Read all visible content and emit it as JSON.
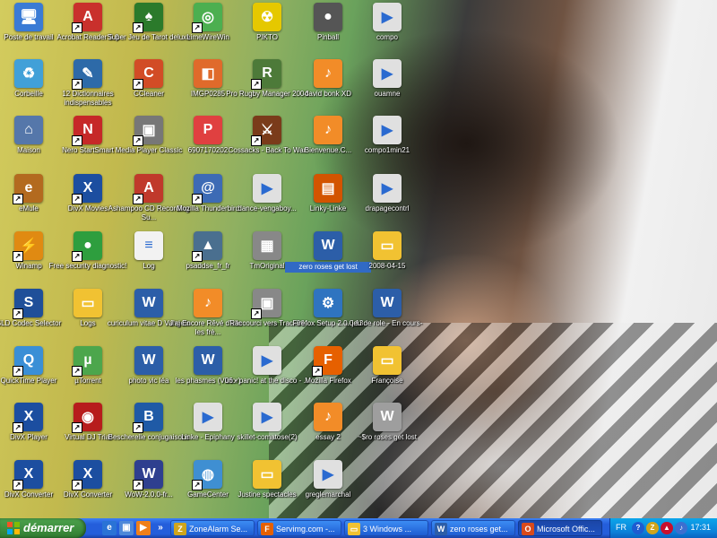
{
  "desktop_icons": [
    {
      "label": "Poste de travail",
      "symbol": "🖥",
      "color": "#3a7bd5"
    },
    {
      "label": "Acrobat Reader 5.0",
      "symbol": "A",
      "color": "#c9302c",
      "shortcut": true
    },
    {
      "label": "Super Jeu de Tarot deluxe",
      "symbol": "♠",
      "color": "#2b7a2b",
      "shortcut": true
    },
    {
      "label": "LimeWireWin",
      "symbol": "◎",
      "color": "#4caf50",
      "shortcut": true
    },
    {
      "label": "PIKTO",
      "symbol": "☢",
      "color": "#e5c800"
    },
    {
      "label": "Pinball",
      "symbol": "●",
      "color": "#555"
    },
    {
      "label": "compo",
      "symbol": "▶",
      "color": "#e0e0e0"
    },
    {
      "label": "Corbeille",
      "symbol": "♻",
      "color": "#41a0d8"
    },
    {
      "label": "12 Dictionnaires indispensables",
      "symbol": "✎",
      "color": "#2d6aa8",
      "shortcut": true
    },
    {
      "label": "CCleaner",
      "symbol": "C",
      "color": "#d24c26",
      "shortcut": true
    },
    {
      "label": "IMGP0285",
      "symbol": "◧",
      "color": "#e06a2b"
    },
    {
      "label": "Pro Rugby Manager 2004",
      "symbol": "R",
      "color": "#4d7a39",
      "shortcut": true
    },
    {
      "label": "david bonk XD",
      "symbol": "♪",
      "color": "#f28c28"
    },
    {
      "label": "ouamne",
      "symbol": "▶",
      "color": "#e0e0e0"
    },
    {
      "label": "Maison",
      "symbol": "⌂",
      "color": "#5577aa"
    },
    {
      "label": "Nero StartSmart",
      "symbol": "N",
      "color": "#c62828",
      "shortcut": true
    },
    {
      "label": "Media Player Classic",
      "symbol": "▣",
      "color": "#777",
      "shortcut": true
    },
    {
      "label": "6907170202",
      "symbol": "P",
      "color": "#e04040"
    },
    {
      "label": "Cossacks - Back To War",
      "symbol": "⚔",
      "color": "#7a3b1a",
      "shortcut": true
    },
    {
      "label": "Bienvenue.C...",
      "symbol": "♪",
      "color": "#f28c28"
    },
    {
      "label": "compo1min21",
      "symbol": "▶",
      "color": "#e0e0e0"
    },
    {
      "label": "eMule",
      "symbol": "e",
      "color": "#b36a1f",
      "shortcut": true
    },
    {
      "label": "DivX Movies",
      "symbol": "X",
      "color": "#1c4ea0",
      "shortcut": true
    },
    {
      "label": "Ashampoo CD Recording Su...",
      "symbol": "A",
      "color": "#c0392b",
      "shortcut": true
    },
    {
      "label": "Mozilla Thunderbird",
      "symbol": "@",
      "color": "#3d6bb5",
      "shortcut": true
    },
    {
      "label": "dance-vengaboy...",
      "symbol": "▶",
      "color": "#e0e0e0"
    },
    {
      "label": "Linky-Linke",
      "symbol": "▤",
      "color": "#d35400"
    },
    {
      "label": "drapagecontrl",
      "symbol": "▶",
      "color": "#e0e0e0"
    },
    {
      "label": "Winamp",
      "symbol": "⚡",
      "color": "#e08a12",
      "shortcut": true
    },
    {
      "label": "Free security diagnostic!",
      "symbol": "●",
      "color": "#2e9e3e",
      "shortcut": true
    },
    {
      "label": "Log",
      "symbol": "≡",
      "color": "#f2f2f2"
    },
    {
      "label": "psaddse_fr_fr",
      "symbol": "▲",
      "color": "#4a6f8f",
      "shortcut": true
    },
    {
      "label": "TmOriginal",
      "symbol": "▦",
      "color": "#888"
    },
    {
      "label": "zero roses get lost",
      "symbol": "W",
      "color": "#2c5ea8",
      "selected": true
    },
    {
      "label": "2008-04-15",
      "symbol": "▭",
      "color": "#f1c232"
    },
    {
      "label": "SLD Codec Selector",
      "symbol": "S",
      "color": "#1f4f99",
      "shortcut": true
    },
    {
      "label": "Logs",
      "symbol": "▭",
      "color": "#f1c232"
    },
    {
      "label": "curiculum vitae D Vangelo",
      "symbol": "W",
      "color": "#2c5ea8"
    },
    {
      "label": "J'ai Encore Rêvé d'elle - les frè...",
      "symbol": "♪",
      "color": "#f28c28"
    },
    {
      "label": "Raccourci vers Track06",
      "symbol": "▣",
      "color": "#888",
      "shortcut": true
    },
    {
      "label": "Firefox Setup 2.0.0.13",
      "symbol": "⚙",
      "color": "#2f74c0"
    },
    {
      "label": "jeu de role - En cours-",
      "symbol": "W",
      "color": "#2c5ea8"
    },
    {
      "label": "QuickTime Player",
      "symbol": "Q",
      "color": "#3a8fd6",
      "shortcut": true
    },
    {
      "label": "µTorrent",
      "symbol": "µ",
      "color": "#4ca64c",
      "shortcut": true
    },
    {
      "label": "photo vic léa",
      "symbol": "W",
      "color": "#2c5ea8"
    },
    {
      "label": "les phasmes (Victor)",
      "symbol": "W",
      "color": "#2c5ea8"
    },
    {
      "label": "06 - panic! at the disco - ...",
      "symbol": "▶",
      "color": "#e0e0e0"
    },
    {
      "label": "Mozilla Firefox",
      "symbol": "F",
      "color": "#e66000",
      "shortcut": true
    },
    {
      "label": "Françoise",
      "symbol": "▭",
      "color": "#f1c232"
    },
    {
      "label": "DivX Player",
      "symbol": "X",
      "color": "#1c4ea0",
      "shortcut": true
    },
    {
      "label": "Virtual DJ Trial",
      "symbol": "◉",
      "color": "#b71c1c",
      "shortcut": true
    },
    {
      "label": "Bescherelle conjugaisons",
      "symbol": "B",
      "color": "#1f5aa6",
      "shortcut": true
    },
    {
      "label": "Linke - Epiphany",
      "symbol": "▶",
      "color": "#e0e0e0"
    },
    {
      "label": "skillet-comatose(2)",
      "symbol": "▶",
      "color": "#e0e0e0"
    },
    {
      "label": "essay 2",
      "symbol": "♪",
      "color": "#f28c28"
    },
    {
      "label": "~$ro roses get lost",
      "symbol": "W",
      "color": "#9e9e9e"
    },
    {
      "label": "DivX Converter",
      "symbol": "X",
      "color": "#1c4ea0",
      "shortcut": true
    },
    {
      "label": "DivX Converter",
      "symbol": "X",
      "color": "#1c4ea0",
      "shortcut": true
    },
    {
      "label": "WoW-2.0.0-fr...",
      "symbol": "W",
      "color": "#2e3f8f",
      "shortcut": true
    },
    {
      "label": "GameCenter",
      "symbol": "◍",
      "color": "#3f8fd2",
      "shortcut": true
    },
    {
      "label": "Justine spectacles",
      "symbol": "▭",
      "color": "#f1c232"
    },
    {
      "label": "greglemarchal",
      "symbol": "▶",
      "color": "#e0e0e0"
    }
  ],
  "taskbar": {
    "start_label": "démarrer",
    "quick_launch": [
      {
        "name": "ie-quick-launch",
        "symbol": "e",
        "color": "#2a73d6"
      },
      {
        "name": "window-quick-launch",
        "symbol": "▣",
        "color": "#4d88d9"
      },
      {
        "name": "media-quick-launch",
        "symbol": "▶",
        "color": "#ef7f1a"
      },
      {
        "name": "more-quick-launch",
        "symbol": "»",
        "color": "transparent"
      }
    ],
    "tasks": [
      {
        "label": "ZoneAlarm Se...",
        "symbol": "Z",
        "color": "#cfa51c",
        "active": false
      },
      {
        "label": "Servimg.com -...",
        "symbol": "F",
        "color": "#e66000",
        "active": false
      },
      {
        "label": "3 Windows ...",
        "symbol": "▭",
        "color": "#f1c232",
        "active": false
      },
      {
        "label": "zero roses get...",
        "symbol": "W",
        "color": "#2c5ea8",
        "active": false
      },
      {
        "label": "Microsoft Offic...",
        "symbol": "O",
        "color": "#d84a1b",
        "active": true
      }
    ],
    "tray": {
      "language": "FR",
      "time": "17:31",
      "icons": [
        {
          "name": "help-tray-icon",
          "symbol": "?",
          "color": "#1d5cd1"
        },
        {
          "name": "zonealarm-tray-icon",
          "symbol": "Z",
          "color": "#cfa51c"
        },
        {
          "name": "security-tray-icon",
          "symbol": "▲",
          "color": "#c8102e"
        },
        {
          "name": "speaker-tray-icon",
          "symbol": "♪",
          "color": "#3c6fd0"
        }
      ]
    }
  }
}
